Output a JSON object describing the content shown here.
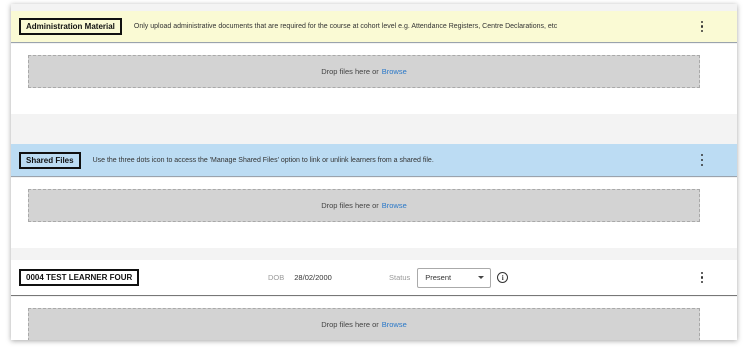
{
  "admin": {
    "title": "Administration Material",
    "description": "Only upload administrative documents that are required for the course at cohort level e.g. Attendance Registers, Centre Declarations, etc",
    "drop_text": "Drop files here or",
    "browse_label": "Browse"
  },
  "shared": {
    "title": "Shared Files",
    "description": "Use the three dots icon to access the 'Manage Shared Files' option to link or unlink learners from a shared file.",
    "drop_text": "Drop files here or",
    "browse_label": "Browse"
  },
  "learner": {
    "title": "0004 TEST LEARNER FOUR",
    "dob_label": "DOB",
    "dob_value": "28/02/2000",
    "status_label": "Status",
    "status_value": "Present",
    "info_glyph": "i",
    "drop_text": "Drop files here or",
    "browse_label": "Browse"
  },
  "icons": {
    "menu": "kebab-menu-icon",
    "info": "info-icon",
    "dropdown": "chevron-down-icon"
  },
  "colors": {
    "admin_header_bg": "#fafad4",
    "shared_header_bg": "#bcdcf3",
    "dropzone_bg": "#d3d3d3",
    "link": "#2a78c8"
  }
}
